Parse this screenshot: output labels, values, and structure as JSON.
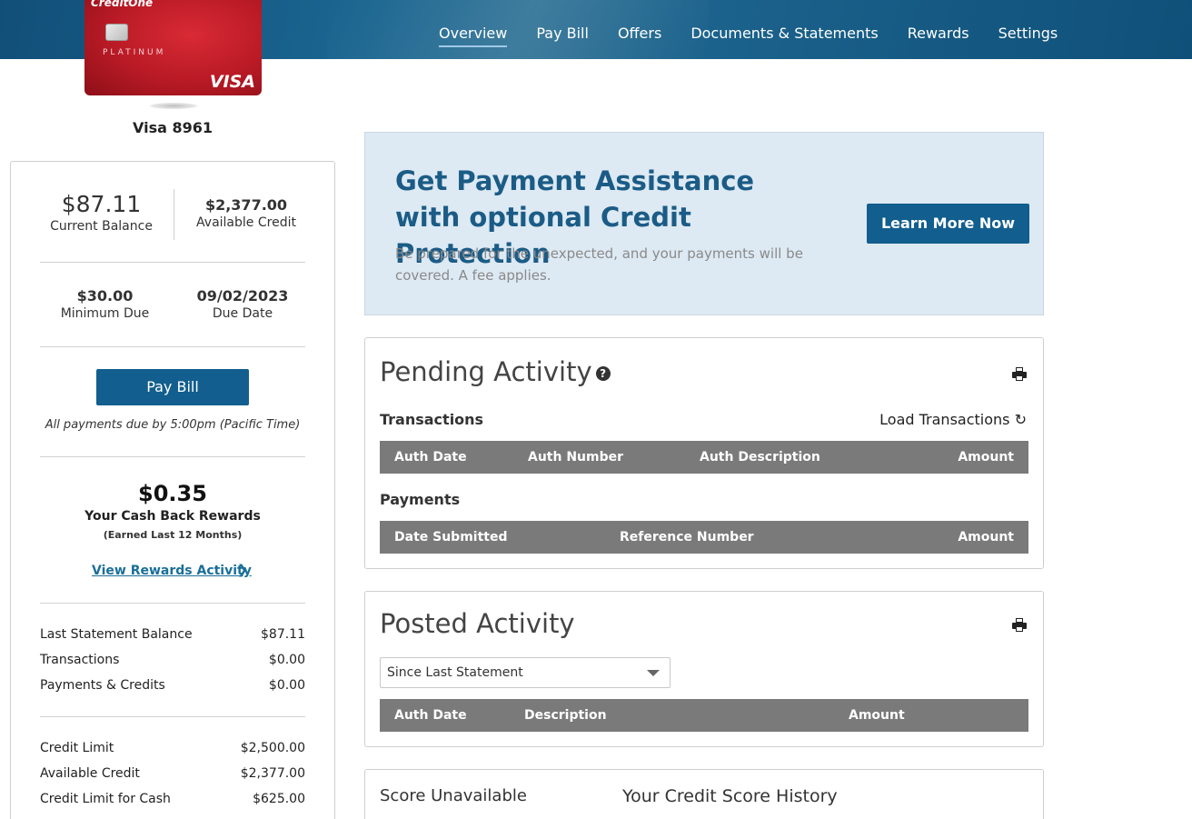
{
  "nav": {
    "items": [
      "Overview",
      "Pay Bill",
      "Offers",
      "Documents & Statements",
      "Rewards",
      "Settings"
    ],
    "active": "Overview"
  },
  "card": {
    "brand": "CreditOne",
    "tier": "PLATINUM",
    "network": "VISA",
    "name": "Visa 8961"
  },
  "summary": {
    "current_balance": "$87.11",
    "current_balance_label": "Current Balance",
    "available_credit": "$2,377.00",
    "available_credit_label": "Available Credit",
    "minimum_due": "$30.00",
    "minimum_due_label": "Minimum Due",
    "due_date": "09/02/2023",
    "due_date_label": "Due Date",
    "pay_button": "Pay Bill",
    "pay_note": "All payments due by 5:00pm (Pacific Time)",
    "rewards_amount": "$0.35",
    "rewards_label": "Your Cash Back Rewards",
    "rewards_sub": "(Earned Last 12 Months)",
    "rewards_link": "View Rewards Activity",
    "statement_rows": [
      {
        "label": "Last Statement Balance",
        "value": "$87.11"
      },
      {
        "label": "Transactions",
        "value": "$0.00"
      },
      {
        "label": "Payments & Credits",
        "value": "$0.00"
      }
    ],
    "credit_rows": [
      {
        "label": "Credit Limit",
        "value": "$2,500.00"
      },
      {
        "label": "Available Credit",
        "value": "$2,377.00"
      },
      {
        "label": "Credit Limit for Cash",
        "value": "$625.00"
      }
    ]
  },
  "promo": {
    "title": "Get Payment Assistance with optional Credit Protection",
    "text": "Be prepared for the unexpected, and your payments will be covered. A fee applies.",
    "button": "Learn More Now"
  },
  "pending": {
    "title": "Pending Activity",
    "transactions_label": "Transactions",
    "load_label": "Load Transactions",
    "transactions_columns": [
      "Auth Date",
      "Auth Number",
      "Auth Description",
      "Amount"
    ],
    "payments_label": "Payments",
    "payments_columns": [
      "Date Submitted",
      "Reference Number",
      "Amount"
    ]
  },
  "posted": {
    "title": "Posted Activity",
    "filter_value": "Since Last Statement",
    "columns": [
      "Auth Date",
      "Description",
      "Amount"
    ]
  },
  "score": {
    "status": "Score Unavailable",
    "history_title": "Your Credit Score History"
  }
}
